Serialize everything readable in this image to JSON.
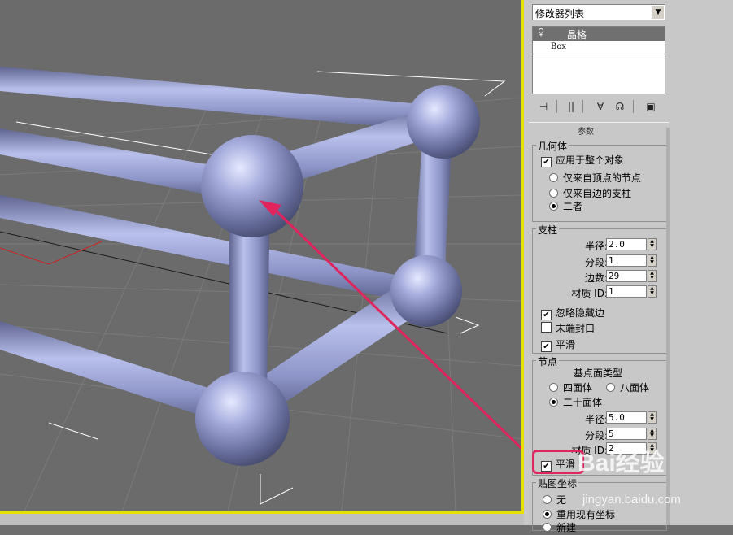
{
  "panel": {
    "modifier_list": "修改器列表",
    "stack": {
      "selected": "晶格",
      "base": "Box"
    },
    "toolbar_icons": [
      "pin-stack-icon",
      "show-end-result-icon",
      "make-unique-icon",
      "remove-modifier-icon",
      "configure-modifier-sets-icon"
    ],
    "rollout_title": "参数",
    "geometry": {
      "title": "几何体",
      "apply_whole": "应用于整个对象",
      "apply_whole_checked": true,
      "options": [
        "仅来自顶点的节点",
        "仅来自边的支柱",
        "二者"
      ],
      "selected_option": 2
    },
    "struts": {
      "title": "支柱",
      "radius_label": "半径:",
      "radius_value": "2.0",
      "segments_label": "分段:",
      "segments_value": "1",
      "sides_label": "边数:",
      "sides_value": "29",
      "material_label": "材质 ID:",
      "material_value": "1",
      "ignore_hidden": "忽略隐藏边",
      "ignore_hidden_checked": true,
      "end_caps": "末端封口",
      "end_caps_checked": false,
      "smooth": "平滑",
      "smooth_checked": true
    },
    "joints": {
      "title": "节点",
      "geodesic_label": "基点面类型",
      "tetra": "四面体",
      "octa": "八面体",
      "icosa": "二十面体",
      "selected_type": "icosa",
      "radius_label": "半径:",
      "radius_value": "5.0",
      "segments_label": "分段:",
      "segments_value": "5",
      "material_label": "材质 ID:",
      "material_value": "2",
      "smooth": "平滑",
      "smooth_checked": true
    },
    "mapping": {
      "title": "贴图坐标",
      "none": "无",
      "reuse": "重用现有坐标",
      "new": "新建"
    }
  },
  "watermark": {
    "brand": "Bai经验",
    "url": "jingyan.baidu.com"
  },
  "colors": {
    "viewport_bg": "#6b6b6b",
    "active_viewport_border": "#e8e000",
    "lattice_color": "#9aa3d4",
    "highlight": "#e0245e"
  }
}
